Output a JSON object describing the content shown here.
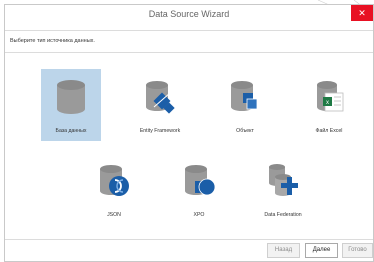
{
  "window": {
    "title": "Data Source Wizard",
    "close_glyph": "✕"
  },
  "subtitle": "Выберите тип источника данных.",
  "tiles": [
    {
      "label": "База данных",
      "icon": "database-icon",
      "selected": true
    },
    {
      "label": "Entity Framework",
      "icon": "entity-framework-icon"
    },
    {
      "label": "Объект",
      "icon": "object-icon"
    },
    {
      "label": "Файл Excel",
      "icon": "excel-file-icon"
    },
    {
      "label": "JSON",
      "icon": "json-icon"
    },
    {
      "label": "XPO",
      "icon": "xpo-icon"
    },
    {
      "label": "Data Federation",
      "icon": "data-federation-icon"
    }
  ],
  "buttons": {
    "back": "Назад",
    "next": "Далее",
    "finish": "Готово"
  },
  "colors": {
    "selected_bg": "#bcd5ea",
    "accent_blue": "#1b5ea8",
    "close_red": "#e81123",
    "cylinder_gray": "#9a9a9a"
  }
}
